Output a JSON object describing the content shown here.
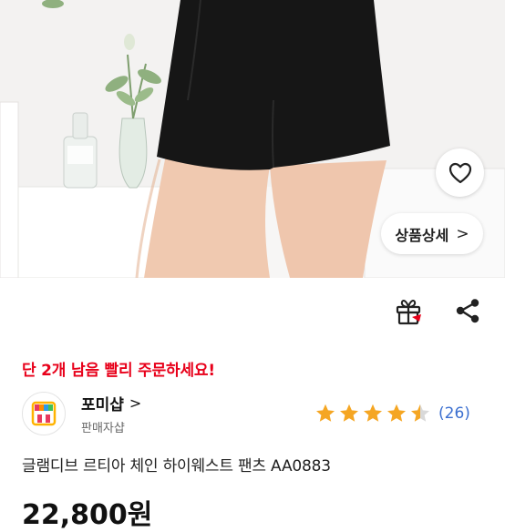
{
  "product": {
    "detail_button_label": "상품상세",
    "detail_chevron": ">",
    "wishlist_icon": "heart-icon",
    "gift_icon": "gift-icon",
    "share_icon": "share-icon"
  },
  "stock_alert": "단 2개 남음 빨리 주문하세요!",
  "shop": {
    "name": "포미샵",
    "chevron": ">",
    "type": "판매자샵"
  },
  "rating": {
    "stars": 4.5,
    "max": 5,
    "review_count": "(26)",
    "star_color": "#f5a623"
  },
  "title": "글램디브 르티아 체인 하이웨스트 팬츠 AA0883",
  "price": "22,800원",
  "colors": {
    "alert": "#e8001a",
    "link": "#3b6fd0"
  }
}
